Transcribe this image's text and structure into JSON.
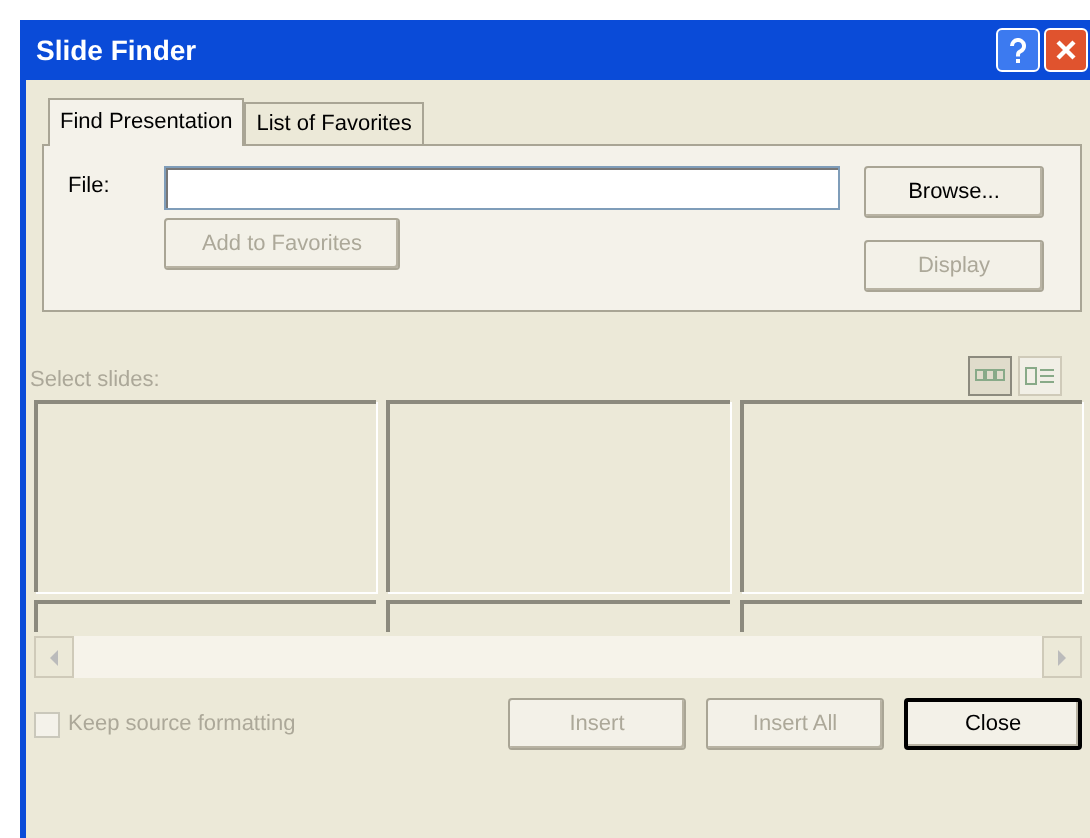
{
  "window": {
    "title": "Slide Finder"
  },
  "tabs": [
    {
      "label": "Find Presentation",
      "selected": true
    },
    {
      "label": "List of Favorites",
      "selected": false
    }
  ],
  "file": {
    "label": "File:"
  },
  "panel_buttons": [
    {
      "label": "Browse...",
      "disabled": false
    },
    {
      "label": "Add to Favorites",
      "disabled": true
    },
    {
      "label": "Display",
      "disabled": true
    }
  ],
  "select_slides": {
    "label": "Select slides:",
    "disabled": true
  },
  "view_modes": [
    {
      "kind": "thumbnails",
      "selected": true
    },
    {
      "kind": "list",
      "selected": false
    }
  ],
  "slides": [
    {
      "kind": "empty"
    },
    {
      "kind": "empty"
    },
    {
      "kind": "empty"
    }
  ],
  "keep_source_formatting": {
    "label": "Keep source formatting",
    "checked": false,
    "disabled": true
  },
  "buttons": [
    {
      "label": "Insert",
      "disabled": true,
      "default": false
    },
    {
      "label": "Insert All",
      "disabled": true,
      "default": false
    },
    {
      "label": "Close",
      "disabled": false,
      "default": true
    }
  ]
}
